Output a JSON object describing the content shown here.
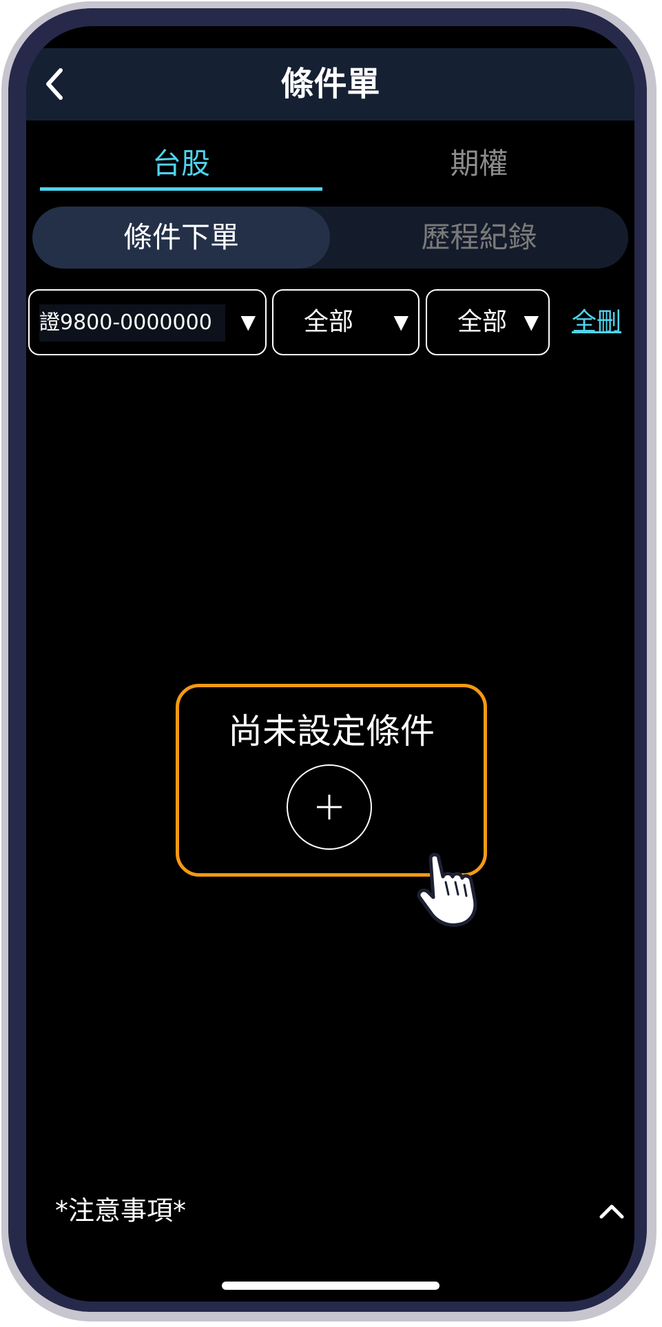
{
  "header": {
    "title": "條件單"
  },
  "tabs": [
    {
      "label": "台股",
      "active": true
    },
    {
      "label": "期權",
      "active": false
    }
  ],
  "segments": [
    {
      "label": "條件下單",
      "active": true
    },
    {
      "label": "歷程紀錄",
      "active": false
    }
  ],
  "filters": {
    "account": "證9800-0000000",
    "type": "全部",
    "status": "全部",
    "arrow": "▼",
    "delete_all": "全刪"
  },
  "empty_state": {
    "message": "尚未設定條件",
    "add_icon": "plus-icon"
  },
  "footer": {
    "notice": "*注意事項*",
    "expand_icon": "chevron-up-icon"
  },
  "colors": {
    "accent": "#4fd4ef",
    "highlight": "#f39a13",
    "header_bg": "#152033",
    "frame": "#26294a"
  }
}
